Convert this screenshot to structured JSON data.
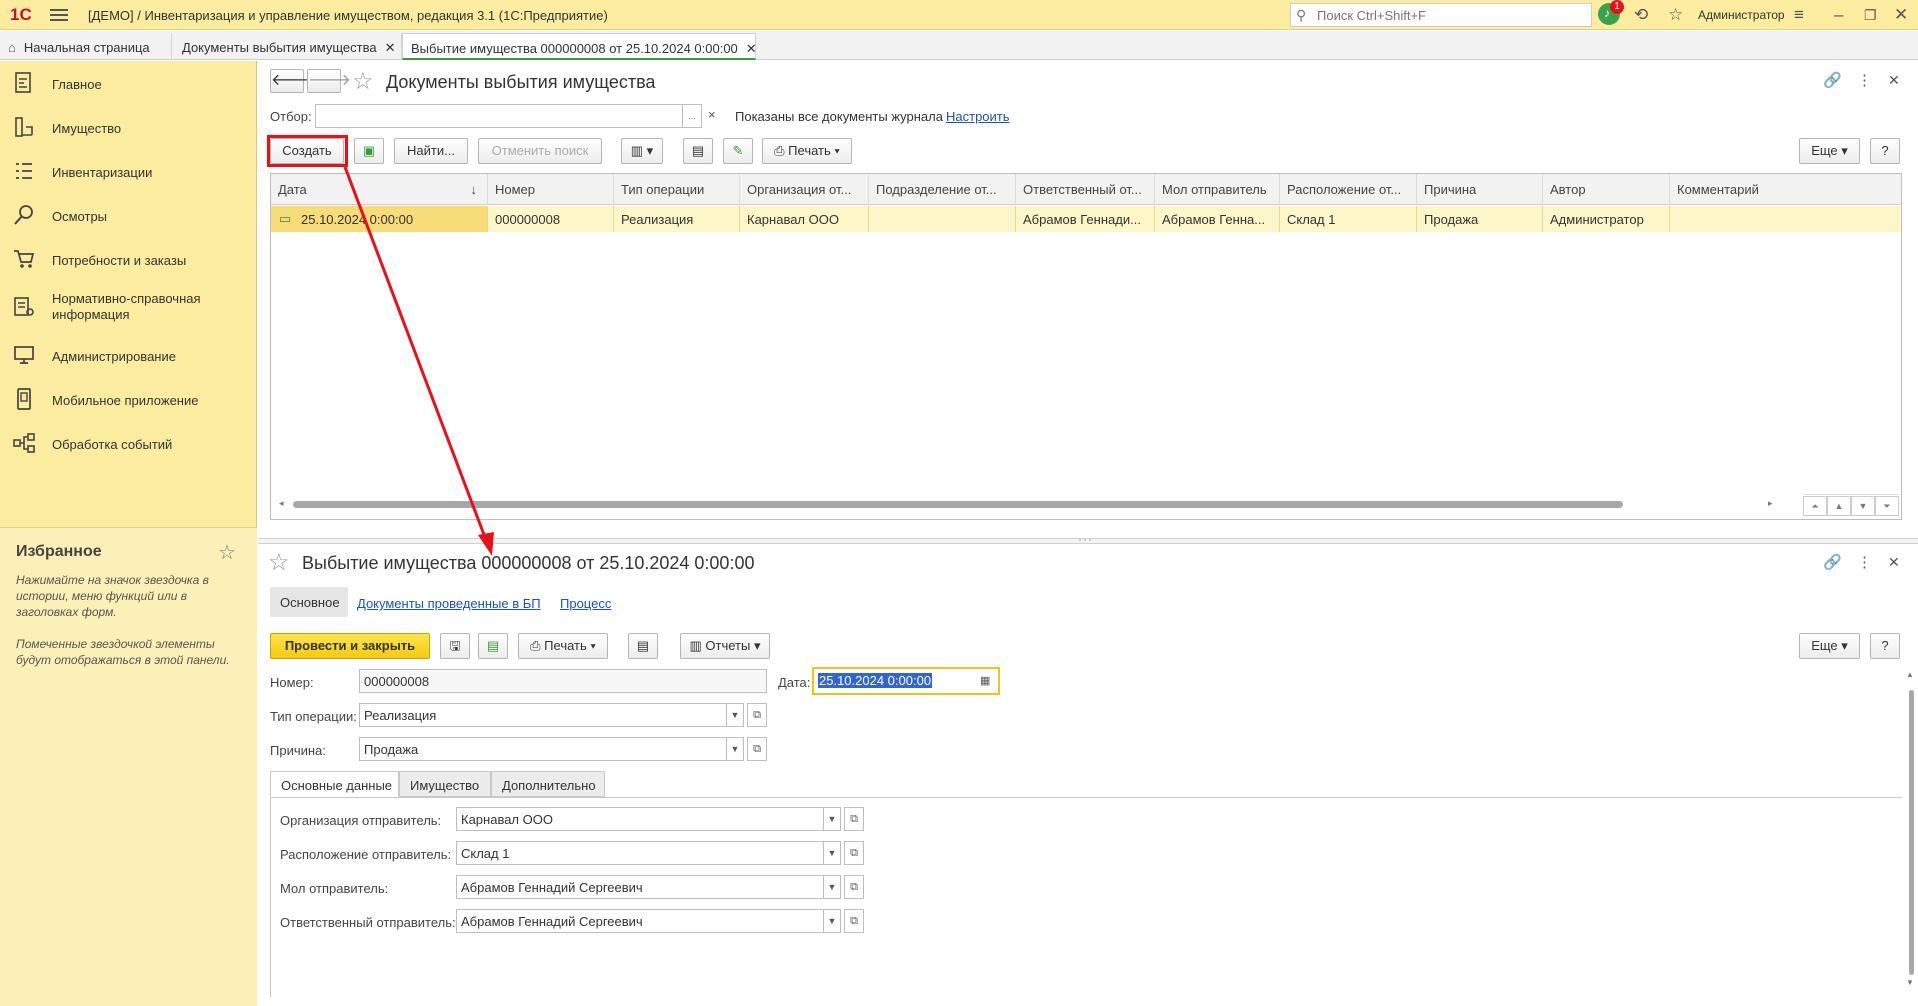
{
  "titlebar": {
    "logo": "1С",
    "title": "[ДЕМО] / Инвентаризация и управление имуществом, редакция 3.1  (1С:Предприятие)",
    "search_placeholder": "Поиск Ctrl+Shift+F",
    "notification_count": "1",
    "user": "Администратор"
  },
  "tabs": [
    {
      "label": "Начальная страница"
    },
    {
      "label": "Документы выбытия имущества"
    },
    {
      "label": "Выбытие имущества 000000008 от 25.10.2024 0:00:00"
    }
  ],
  "sidebar": {
    "items": [
      {
        "label": "Главное"
      },
      {
        "label": "Имущество"
      },
      {
        "label": "Инвентаризации"
      },
      {
        "label": "Осмотры"
      },
      {
        "label": "Потребности и заказы"
      },
      {
        "label": "Нормативно-справочная информация"
      },
      {
        "label": "Администрирование"
      },
      {
        "label": "Мобильное приложение"
      },
      {
        "label": "Обработка событий"
      }
    ],
    "favorites": {
      "title": "Избранное",
      "hint1": "Нажимайте на значок звездочка в истории, меню функций или в заголовках форм.",
      "hint2": "Помеченные звездочкой элементы будут отображаться в этой панели."
    }
  },
  "list": {
    "title": "Документы выбытия имущества",
    "filter_label": "Отбор:",
    "filter_btn": "...",
    "filter_clear": "×",
    "filter_info": "Показаны все документы журнала",
    "filter_setup": "Настроить",
    "create": "Создать",
    "find": "Найти...",
    "cancel_search": "Отменить поиск",
    "print": "Печать",
    "more": "Еще",
    "help": "?",
    "columns": [
      "Дата",
      "Номер",
      "Тип операции",
      "Организация от...",
      "Подразделение от...",
      "Ответственный от...",
      "Мол отправитель",
      "Расположение от...",
      "Причина",
      "Автор",
      "Комментарий"
    ],
    "rows": [
      [
        "25.10.2024 0:00:00",
        "000000008",
        "Реализация",
        "Карнавал ООО",
        "",
        "Абрамов Геннади...",
        "Абрамов Генна...",
        "Склад 1",
        "Продажа",
        "Администратор",
        ""
      ]
    ]
  },
  "doc": {
    "title": "Выбытие имущества 000000008 от 25.10.2024 0:00:00",
    "nav": {
      "main": "Основное",
      "bp_docs": "Документы проведенные в БП",
      "process": "Процесс"
    },
    "post_close": "Провести и закрыть",
    "print": "Печать",
    "reports": "Отчеты",
    "more": "Еще",
    "help": "?",
    "number_label": "Номер:",
    "number": "000000008",
    "date_label": "Дата:",
    "date": "25.10.2024  0:00:00",
    "optype_label": "Тип операции:",
    "optype": "Реализация",
    "reason_label": "Причина:",
    "reason": "Продажа",
    "inner_tabs": [
      "Основные данные",
      "Имущество",
      "Дополнительно"
    ],
    "org_label": "Организация отправитель:",
    "org": "Карнавал ООО",
    "loc_label": "Расположение отправитель:",
    "loc": "Склад 1",
    "mol_label": "Мол отправитель:",
    "mol": "Абрамов Геннадий Сергеевич",
    "resp_label": "Ответственный отправитель:",
    "resp": "Абрамов Геннадий Сергеевич"
  },
  "colors": {
    "highlight": "#e8101a",
    "sidebar": "#fbeca0",
    "accent_yellow": "#f3cb0f"
  }
}
